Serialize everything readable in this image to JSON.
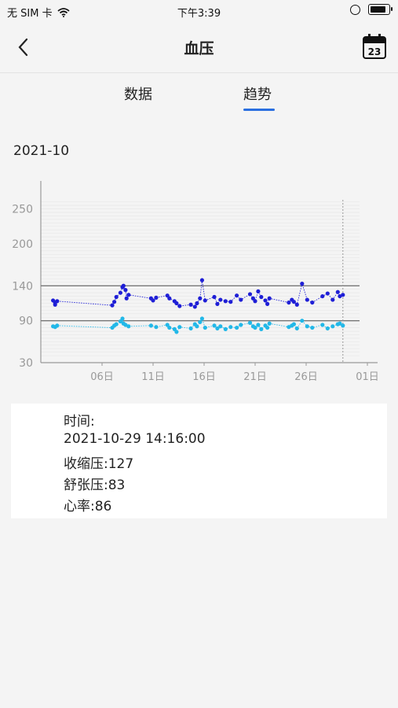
{
  "status_bar": {
    "carrier": "无 SIM 卡",
    "time": "下午3:39",
    "battery_level": 0.85
  },
  "nav": {
    "title": "血压",
    "calendar_day": "23"
  },
  "tabs": [
    {
      "label": "数据",
      "active": false
    },
    {
      "label": "趋势",
      "active": true
    }
  ],
  "month_label": "2021-10",
  "colors": {
    "systolic": "#1f1fd6",
    "diastolic": "#22b8e8",
    "accent": "#2b6fe0"
  },
  "chart_data": {
    "type": "scatter",
    "xlim": [
      0,
      33
    ],
    "ylim": [
      30,
      290
    ],
    "y_ticks": [
      30,
      90,
      140,
      200,
      250
    ],
    "y_tick_labels": [
      "30",
      "90",
      "140",
      "200",
      "250"
    ],
    "x_ticks": [
      6,
      11,
      16,
      21,
      26,
      32
    ],
    "x_tick_labels": [
      "06日",
      "11日",
      "16日",
      "21日",
      "26日",
      "01日"
    ],
    "reference_lines": [
      140,
      90
    ],
    "selected_x": 29.6,
    "series": [
      {
        "x": [
          1.2,
          1.4,
          1.4,
          1.6,
          7.0,
          7.2,
          7.4,
          7.8,
          8.0,
          8.1,
          8.3,
          8.4,
          8.6,
          10.8,
          11.0,
          11.3,
          12.4,
          12.6,
          13.1,
          13.3,
          13.6,
          14.7,
          15.1,
          15.3,
          15.6,
          15.8,
          16.1,
          17.0,
          17.3,
          17.6,
          18.1,
          18.6,
          19.2,
          19.6,
          20.5,
          20.8,
          21.0,
          21.3,
          21.6,
          22.0,
          22.2,
          22.4,
          24.3,
          24.6,
          24.8,
          25.1,
          25.6,
          26.1,
          26.6,
          27.6,
          28.1,
          28.6,
          29.1,
          29.3,
          29.6
        ],
        "y": [
          119,
          116,
          113,
          118,
          112,
          117,
          124,
          130,
          138,
          140,
          134,
          122,
          127,
          122,
          119,
          123,
          126,
          122,
          118,
          115,
          111,
          113,
          110,
          115,
          122,
          148,
          119,
          124,
          114,
          120,
          118,
          117,
          126,
          120,
          128,
          122,
          118,
          132,
          124,
          119,
          114,
          122,
          116,
          120,
          117,
          113,
          143,
          120,
          116,
          125,
          129,
          120,
          131,
          125,
          127
        ]
      },
      {
        "x": [
          1.2,
          1.4,
          1.6,
          7.0,
          7.2,
          7.4,
          7.8,
          8.0,
          8.1,
          8.3,
          8.6,
          10.8,
          11.3,
          12.4,
          12.6,
          13.1,
          13.3,
          13.6,
          14.7,
          15.1,
          15.3,
          15.6,
          15.8,
          16.1,
          17.0,
          17.3,
          17.6,
          18.1,
          18.6,
          19.2,
          19.6,
          20.5,
          20.8,
          21.0,
          21.3,
          21.6,
          22.0,
          22.2,
          22.4,
          24.3,
          24.6,
          24.8,
          25.1,
          25.6,
          26.1,
          26.6,
          27.6,
          28.1,
          28.6,
          29.1,
          29.3,
          29.6
        ],
        "y": [
          82,
          81,
          83,
          80,
          83,
          85,
          89,
          93,
          86,
          84,
          82,
          83,
          81,
          84,
          80,
          78,
          74,
          81,
          79,
          85,
          82,
          88,
          93,
          80,
          83,
          79,
          82,
          78,
          81,
          80,
          84,
          87,
          82,
          80,
          84,
          78,
          83,
          80,
          86,
          81,
          83,
          85,
          79,
          90,
          82,
          80,
          84,
          79,
          82,
          85,
          86,
          83
        ]
      }
    ]
  },
  "detail": {
    "time_label": "时间:",
    "datetime": "2021-10-29 14:16:00",
    "systolic": "收缩压:127",
    "diastolic": "舒张压:83",
    "heart_rate": "心率:86"
  }
}
